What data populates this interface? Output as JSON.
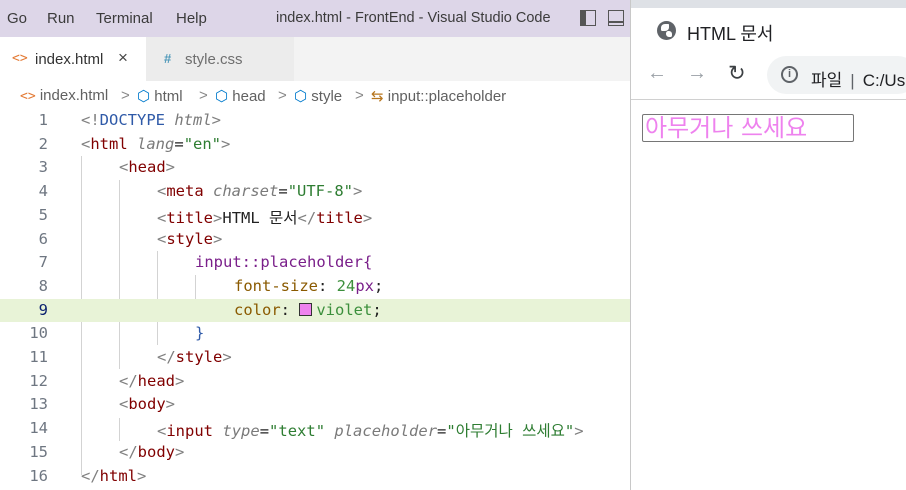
{
  "titlebar": {
    "menu": [
      "Go",
      "Run",
      "Terminal",
      "Help"
    ],
    "window_title": "index.html - FrontEnd - Visual Studio Code"
  },
  "tabs": [
    {
      "icon": "<>",
      "label": "index.html",
      "close": "×",
      "active": true
    },
    {
      "icon": "#",
      "label": "style.css",
      "active": false
    }
  ],
  "breadcrumb": {
    "file": "index.html",
    "items": [
      "html",
      "head",
      "style",
      "input::placeholder"
    ],
    "separator": ">"
  },
  "editor": {
    "active_line": 9,
    "line_numbers": [
      "1",
      "2",
      "3",
      "4",
      "5",
      "6",
      "7",
      "8",
      "9",
      "10",
      "11",
      "12",
      "13",
      "14",
      "15",
      "16"
    ],
    "swatch_color": "#ee82ee",
    "code": {
      "l1_open": "<!",
      "l1_doctype": "DOCTYPE",
      "l1_html": "html",
      "l1_close": ">",
      "html_tag": "html",
      "lang_attr": "lang",
      "lang_val": "\"en\"",
      "head_tag": "head",
      "meta_tag": "meta",
      "charset_attr": "charset",
      "charset_val": "\"UTF-8\"",
      "title_tag": "title",
      "title_text": "HTML 문서",
      "style_tag": "style",
      "selector": "input::placeholder{",
      "prop1": "font-size",
      "val1_num": "24",
      "val1_unit": "px",
      "prop2": "color",
      "val2": "violet",
      "close_brace": "}",
      "body_tag": "body",
      "input_tag": "input",
      "type_attr": "type",
      "type_val": "\"text\"",
      "placeholder_attr": "placeholder",
      "placeholder_val": "\"아무거나 쓰세요\""
    }
  },
  "browser": {
    "tab_title": "HTML 문서",
    "address_scheme": "파일",
    "address_text": "C:/Us",
    "input_placeholder": "아무거나 쓰세요",
    "placeholder_color": "#ee82ee"
  }
}
